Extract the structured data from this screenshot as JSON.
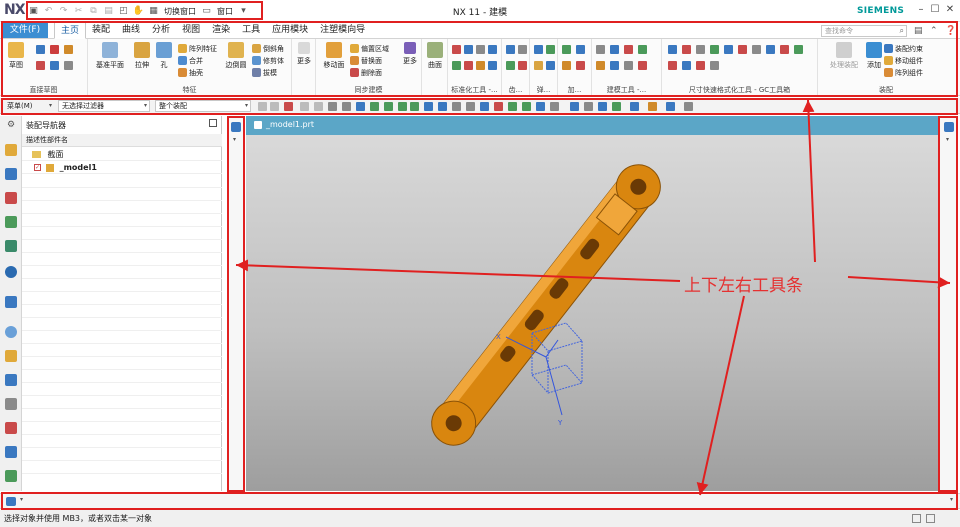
{
  "window": {
    "logo": "NX",
    "title": "NX 11 - 建模",
    "brand": "SIEMENS"
  },
  "quick_access": {
    "switch_window": "切换窗口",
    "window_menu": "窗口"
  },
  "tabs": {
    "file": "文件(F)",
    "items": [
      "主页",
      "装配",
      "曲线",
      "分析",
      "视图",
      "渲染",
      "工具",
      "应用模块",
      "注塑模向导"
    ],
    "active": "主页",
    "search_placeholder": "查找命令"
  },
  "ribbon": {
    "groups": [
      {
        "label": "直接草图",
        "buttons": [
          "草图"
        ]
      },
      {
        "label": "特征",
        "buttons": [
          "基准平面",
          "拉伸",
          "孔",
          "阵列特征",
          "合并",
          "抽壳",
          "边倒圆",
          "倒斜角",
          "修剪体",
          "拔模"
        ]
      },
      {
        "label": "",
        "buttons": [
          "更多"
        ]
      },
      {
        "label": "同步建模",
        "buttons": [
          "移动面",
          "偏置区域",
          "替换面",
          "删除面",
          "更多"
        ]
      },
      {
        "label": "",
        "buttons": [
          "曲面"
        ]
      },
      {
        "label": "标准化工具 -...",
        "buttons": []
      },
      {
        "label": "齿...",
        "buttons": []
      },
      {
        "label": "弹...",
        "buttons": []
      },
      {
        "label": "加...",
        "buttons": []
      },
      {
        "label": "建模工具 -...",
        "buttons": []
      },
      {
        "label": "尺寸快速格式化工具 - GC工具箱",
        "buttons": []
      },
      {
        "label": "装配",
        "buttons": [
          "处理装配",
          "添加",
          "装配约束",
          "移动组件",
          "阵列组件"
        ]
      }
    ]
  },
  "selection_bar": {
    "menu": "菜单(M)",
    "filter": "无选择过滤器",
    "scope": "整个装配"
  },
  "navigator": {
    "title": "装配导航器",
    "column": "描述性部件名",
    "rows": [
      {
        "label": "截面",
        "checked": false
      },
      {
        "label": "_model1",
        "checked": true
      }
    ]
  },
  "graphics": {
    "tab_label": "_model1.prt",
    "axis_x": "X",
    "axis_y": "Y"
  },
  "annotation": {
    "label": "上下左右工具条",
    "color": "#e02020"
  },
  "status": {
    "text": "选择对象并使用 MB3，或者双击某一对象"
  }
}
